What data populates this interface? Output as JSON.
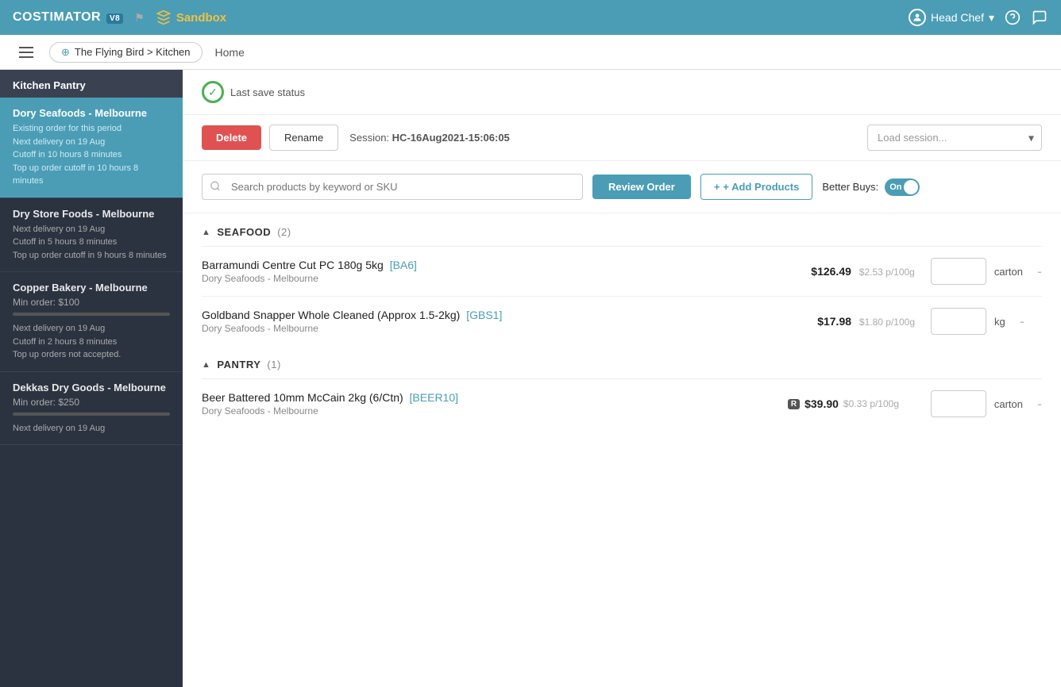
{
  "app": {
    "brand": "COSTIMATOR",
    "brand_version": "V8",
    "sandbox_label": "Sandbox",
    "breadcrumb": "The Flying Bird > Kitchen",
    "home_link": "Home"
  },
  "user": {
    "name": "Head Chef",
    "role": "Head Chef"
  },
  "session": {
    "save_status": "Last save status",
    "delete_label": "Delete",
    "rename_label": "Rename",
    "session_prefix": "Session: ",
    "session_id": "HC-16Aug2021-15:06:05",
    "load_placeholder": "Load session..."
  },
  "toolbar": {
    "search_placeholder": "Search products by keyword or SKU",
    "review_order_label": "Review Order",
    "add_products_label": "+ Add Products",
    "better_buys_label": "Better Buys:",
    "toggle_state": "On"
  },
  "sidebar": {
    "section_title": "Kitchen Pantry",
    "suppliers": [
      {
        "id": "dory",
        "name": "Dory Seafoods - Melbourne",
        "active": true,
        "existing_order": "Existing order for this period",
        "next_delivery": "Next delivery on 19 Aug",
        "cutoff": "Cutoff in 10 hours 8 minutes",
        "top_up": "Top up order cutoff in 10 hours 8 minutes"
      },
      {
        "id": "dry",
        "name": "Dry Store Foods - Melbourne",
        "active": false,
        "next_delivery": "Next delivery on 19 Aug",
        "cutoff": "Cutoff in 5 hours 8 minutes",
        "top_up": "Top up order cutoff in 9 hours 8 minutes"
      },
      {
        "id": "copper",
        "name": "Copper Bakery - Melbourne",
        "active": false,
        "min_order": "Min order: $100",
        "progress": 0,
        "next_delivery": "Next delivery on 19 Aug",
        "cutoff": "Cutoff in 2 hours 8 minutes",
        "top_up": "Top up orders not accepted."
      },
      {
        "id": "dekkas",
        "name": "Dekkas Dry Goods - Melbourne",
        "active": false,
        "min_order": "Min order: $250",
        "progress": 0,
        "next_delivery": "Next delivery on 19 Aug"
      }
    ]
  },
  "categories": [
    {
      "name": "SEAFOOD",
      "count": 2,
      "products": [
        {
          "name": "Barramundi Centre Cut PC 180g 5kg",
          "sku": "[BA6]",
          "supplier": "Dory Seafoods - Melbourne",
          "price": "$126.49",
          "price_per": "$2.53 p/100g",
          "unit": "carton",
          "qty": "",
          "restricted": false
        },
        {
          "name": "Goldband Snapper Whole Cleaned (Approx 1.5-2kg)",
          "sku": "[GBS1]",
          "supplier": "Dory Seafoods - Melbourne",
          "price": "$17.98",
          "price_per": "$1.80 p/100g",
          "unit": "kg",
          "qty": "",
          "restricted": false
        }
      ]
    },
    {
      "name": "PANTRY",
      "count": 1,
      "products": [
        {
          "name": "Beer Battered 10mm McCain 2kg (6/Ctn)",
          "sku": "[BEER10]",
          "supplier": "Dory Seafoods - Melbourne",
          "price": "$39.90",
          "price_per": "$0.33 p/100g",
          "unit": "carton",
          "qty": "",
          "restricted": true
        }
      ]
    }
  ]
}
